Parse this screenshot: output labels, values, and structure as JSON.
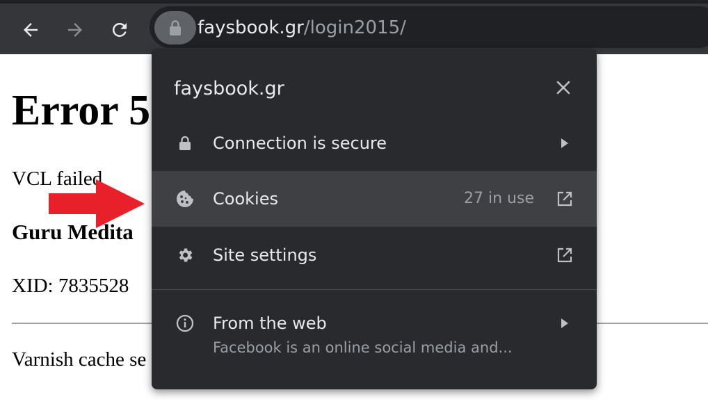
{
  "browser": {
    "url_host": "faysbook.gr",
    "url_path": "/login2015/",
    "icons": {
      "back": "arrow-left-icon",
      "forward": "arrow-right-icon",
      "reload": "reload-icon",
      "lock": "lock-icon"
    }
  },
  "page": {
    "title": "Error 5",
    "line1": "VCL failed",
    "heading": "Guru Medita",
    "xid": "XID: 7835528",
    "footer": "Varnish cache se"
  },
  "popup": {
    "site": "faysbook.gr",
    "rows": [
      {
        "label": "Connection is secure",
        "icon": "lock-icon",
        "trail": "caret-right-icon"
      },
      {
        "label": "Cookies",
        "meta": "27 in use",
        "icon": "cookie-icon",
        "trail": "external-link-icon",
        "highlighted": true
      },
      {
        "label": "Site settings",
        "icon": "gear-icon",
        "trail": "external-link-icon"
      },
      {
        "label": "From the web",
        "sub": "Facebook is an online social media and...",
        "icon": "info-icon",
        "trail": "caret-right-icon"
      }
    ]
  },
  "colors": {
    "toolbar": "#35363a",
    "omnibox": "#202124",
    "popup_bg": "#292a2d",
    "highlight_row": "#3f4044",
    "arrow": "#e8202a"
  }
}
